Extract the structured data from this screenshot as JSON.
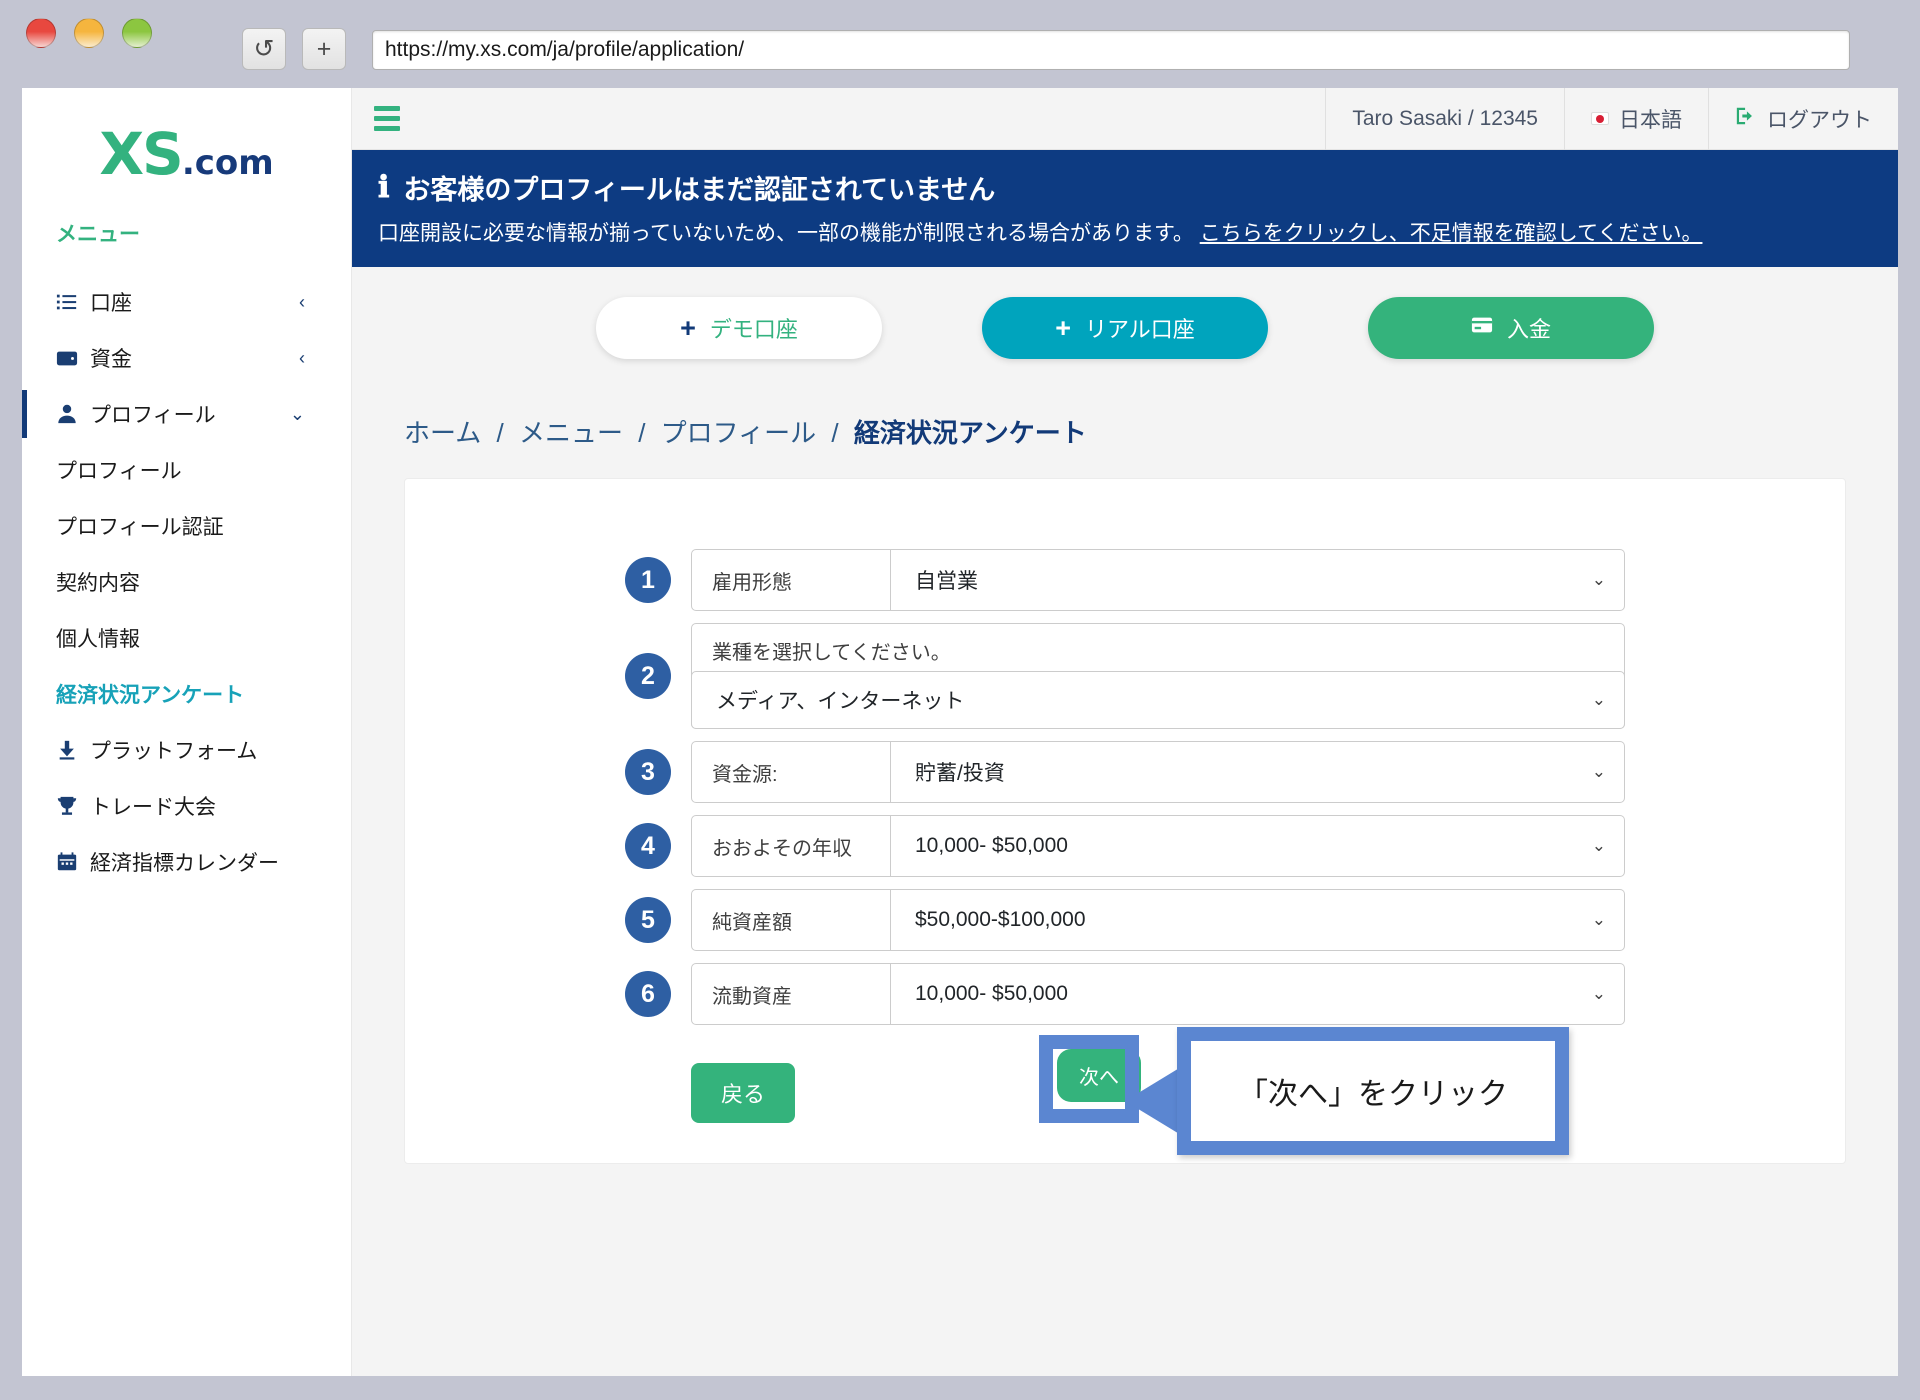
{
  "browser": {
    "url": "https://my.xs.com/ja/profile/application/",
    "reload_icon": "reload-icon",
    "newtab_icon": "plus-icon"
  },
  "sidebar": {
    "logo": {
      "mark": "XS",
      "suffix": ".com"
    },
    "menu_title": "メニュー",
    "nav": [
      {
        "label": "口座",
        "icon": "list-icon",
        "chevron": "‹"
      },
      {
        "label": "資金",
        "icon": "wallet-icon",
        "chevron": "‹"
      },
      {
        "label": "プロフィール",
        "icon": "person-icon",
        "chevron": "⌄"
      }
    ],
    "sub_items": [
      {
        "label": "プロフィール",
        "current": false
      },
      {
        "label": "プロフィール認証",
        "current": false
      },
      {
        "label": "契約内容",
        "current": false
      },
      {
        "label": "個人情報",
        "current": false
      },
      {
        "label": "経済状況アンケート",
        "current": true
      }
    ],
    "nav_bottom": [
      {
        "label": "プラットフォーム",
        "icon": "download-icon"
      },
      {
        "label": "トレード大会",
        "icon": "trophy-icon"
      },
      {
        "label": "経済指標カレンダー",
        "icon": "calendar-icon"
      }
    ]
  },
  "topbar": {
    "hamburger_icon": "hamburger-icon",
    "user": "Taro Sasaki / 12345",
    "language": "日本語",
    "language_icon": "japan-flag-icon",
    "logout": "ログアウト",
    "logout_icon": "logout-icon"
  },
  "banner": {
    "icon": "info-icon",
    "title": "お客様のプロフィールはまだ認証されていません",
    "body": "口座開設に必要な情報が揃っていないため、一部の機能が制限される場合があります。",
    "link": "こちらをクリックし、不足情報を確認してください。",
    "bg_color": "#0d3b82"
  },
  "account_buttons": [
    {
      "label": "デモ口座",
      "icon": "plus-icon",
      "style": "demo",
      "color": "#33b27f"
    },
    {
      "label": "リアル口座",
      "icon": "plus-icon",
      "style": "real",
      "color": "#00a4bd"
    },
    {
      "label": "入金",
      "icon": "credit-card-icon",
      "style": "deposit",
      "color": "#34b37c"
    }
  ],
  "breadcrumb": {
    "items": [
      "ホーム",
      "メニュー",
      "プロフィール"
    ],
    "current": "経済状況アンケート",
    "separator": "/"
  },
  "form": {
    "rows": [
      {
        "number": "1",
        "type": "inline",
        "label": "雇用形態",
        "value": "自営業"
      },
      {
        "number": "2",
        "type": "stacked",
        "question": "業種を選択してください。",
        "value": "メディア、インターネット"
      },
      {
        "number": "3",
        "type": "inline",
        "label": "資金源:",
        "value": "貯蓄/投資"
      },
      {
        "number": "4",
        "type": "inline",
        "label": "おおよその年収",
        "value": "10,000- $50,000"
      },
      {
        "number": "5",
        "type": "inline",
        "label": "純資産額",
        "value": "$50,000-$100,000"
      },
      {
        "number": "6",
        "type": "inline",
        "label": "流動資産",
        "value": "10,000- $50,000"
      }
    ],
    "back_button": "戻る",
    "next_button": "次へ"
  },
  "callout": {
    "text": "「次へ」をクリック",
    "color": "#5b86d1"
  }
}
